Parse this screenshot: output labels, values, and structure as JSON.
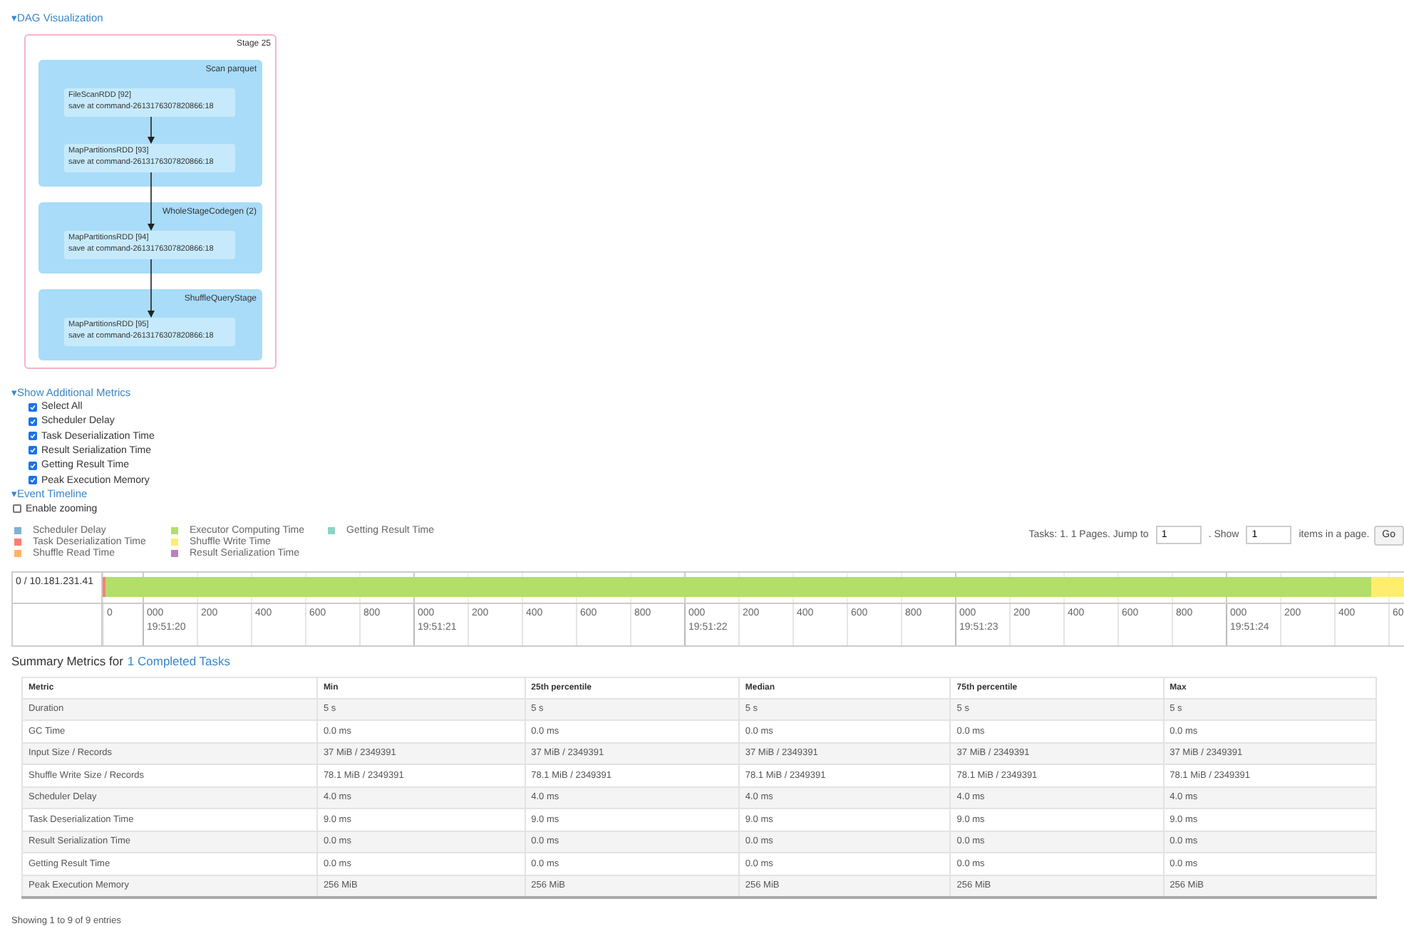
{
  "dag": {
    "toggle": "▾",
    "title": "DAG Visualization",
    "stage": "Stage 25",
    "clusters": [
      {
        "name": "Scan parquet",
        "nodes": [
          {
            "name": "FileScanRDD [92]",
            "callsite": "save at command-2613176307820866:18"
          },
          {
            "name": "MapPartitionsRDD [93]",
            "callsite": "save at command-2613176307820866:18"
          }
        ]
      },
      {
        "name": "WholeStageCodegen (2)",
        "nodes": [
          {
            "name": "MapPartitionsRDD [94]",
            "callsite": "save at command-2613176307820866:18"
          }
        ]
      },
      {
        "name": "ShuffleQueryStage",
        "nodes": [
          {
            "name": "MapPartitionsRDD [95]",
            "callsite": "save at command-2613176307820866:18"
          }
        ]
      }
    ]
  },
  "additional_metrics": {
    "toggle": "▾",
    "title": "Show Additional Metrics",
    "options": [
      {
        "label": "Select All",
        "checked": true
      },
      {
        "label": "Scheduler Delay",
        "checked": true
      },
      {
        "label": "Task Deserialization Time",
        "checked": true
      },
      {
        "label": "Result Serialization Time",
        "checked": true
      },
      {
        "label": "Getting Result Time",
        "checked": true
      },
      {
        "label": "Peak Execution Memory",
        "checked": true
      }
    ]
  },
  "event_timeline": {
    "toggle": "▾",
    "title": "Event Timeline",
    "zoom": {
      "label": "Enable zooming",
      "checked": false
    },
    "legend": [
      {
        "label": "Scheduler Delay",
        "color": "#80b1d3"
      },
      {
        "label": "Task Deserialization Time",
        "color": "#fb8072"
      },
      {
        "label": "Shuffle Read Time",
        "color": "#fdb462"
      },
      {
        "label": "Executor Computing Time",
        "color": "#b3de69"
      },
      {
        "label": "Shuffle Write Time",
        "color": "#ffed6f"
      },
      {
        "label": "Result Serialization Time",
        "color": "#bc80bd"
      },
      {
        "label": "Getting Result Time",
        "color": "#8dd3c7"
      }
    ],
    "pagination": {
      "summary": "Tasks: 1. 1 Pages. Jump to",
      "page_value": "1",
      "show_label": ". Show",
      "size_value": "1",
      "size_suffix": "items in a page.",
      "button": "Go"
    },
    "lane": "0 / 10.181.231.41",
    "ticks": [
      {
        "label": "0"
      },
      {
        "label": "000",
        "time": "19:51:20"
      },
      {
        "label": "200"
      },
      {
        "label": "400"
      },
      {
        "label": "600"
      },
      {
        "label": "800"
      },
      {
        "label": "000",
        "time": "19:51:21"
      },
      {
        "label": "200"
      },
      {
        "label": "400"
      },
      {
        "label": "600"
      },
      {
        "label": "800"
      },
      {
        "label": "000",
        "time": "19:51:22"
      },
      {
        "label": "200"
      },
      {
        "label": "400"
      },
      {
        "label": "600"
      },
      {
        "label": "800"
      },
      {
        "label": "000",
        "time": "19:51:23"
      },
      {
        "label": "200"
      },
      {
        "label": "400"
      },
      {
        "label": "600"
      },
      {
        "label": "800"
      },
      {
        "label": "000",
        "time": "19:51:24"
      },
      {
        "label": "200"
      },
      {
        "label": "400"
      },
      {
        "label": "60"
      }
    ]
  },
  "summary": {
    "title": "Summary Metrics for",
    "link": "1 Completed Tasks",
    "columns": [
      "Metric",
      "Min",
      "25th percentile",
      "Median",
      "75th percentile",
      "Max"
    ],
    "rows": [
      [
        "Duration",
        "5 s",
        "5 s",
        "5 s",
        "5 s",
        "5 s"
      ],
      [
        "GC Time",
        "0.0 ms",
        "0.0 ms",
        "0.0 ms",
        "0.0 ms",
        "0.0 ms"
      ],
      [
        "Input Size / Records",
        "37 MiB / 2349391",
        "37 MiB / 2349391",
        "37 MiB / 2349391",
        "37 MiB / 2349391",
        "37 MiB / 2349391"
      ],
      [
        "Shuffle Write Size / Records",
        "78.1 MiB / 2349391",
        "78.1 MiB / 2349391",
        "78.1 MiB / 2349391",
        "78.1 MiB / 2349391",
        "78.1 MiB / 2349391"
      ],
      [
        "Scheduler Delay",
        "4.0 ms",
        "4.0 ms",
        "4.0 ms",
        "4.0 ms",
        "4.0 ms"
      ],
      [
        "Task Deserialization Time",
        "9.0 ms",
        "9.0 ms",
        "9.0 ms",
        "9.0 ms",
        "9.0 ms"
      ],
      [
        "Result Serialization Time",
        "0.0 ms",
        "0.0 ms",
        "0.0 ms",
        "0.0 ms",
        "0.0 ms"
      ],
      [
        "Getting Result Time",
        "0.0 ms",
        "0.0 ms",
        "0.0 ms",
        "0.0 ms",
        "0.0 ms"
      ],
      [
        "Peak Execution Memory",
        "256 MiB",
        "256 MiB",
        "256 MiB",
        "256 MiB",
        "256 MiB"
      ]
    ],
    "footer": "Showing 1 to 9 of 9 entries"
  }
}
